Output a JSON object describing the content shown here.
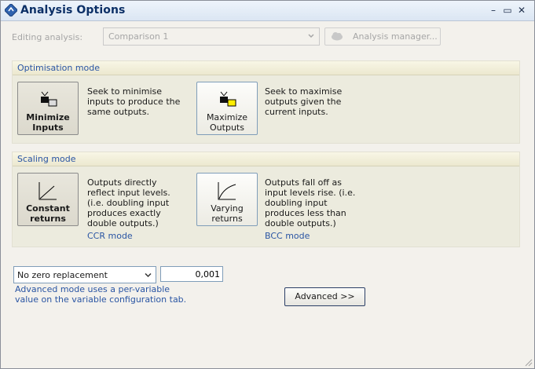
{
  "window": {
    "title": "Analysis Options",
    "icon": "app-logo-icon"
  },
  "controls": {
    "minimize": "–",
    "maximize": "▭",
    "close": "✕"
  },
  "toolbar": {
    "editing_label": "Editing analysis:",
    "analysis_value": "Comparison 1",
    "manager_label": "Analysis manager..."
  },
  "optimisation": {
    "header": "Optimisation mode",
    "minimize_label_1": "Minimize",
    "minimize_label_2": "Inputs",
    "minimize_desc": "Seek to minimise inputs to produce the same outputs.",
    "maximize_label_1": "Maximize",
    "maximize_label_2": "Outputs",
    "maximize_desc": "Seek to maximise outputs given the current inputs."
  },
  "scaling": {
    "header": "Scaling mode",
    "constant_label_1": "Constant",
    "constant_label_2": "returns",
    "constant_desc": "Outputs directly reflect input levels. (i.e. doubling input produces exactly double outputs.)",
    "constant_link": "CCR mode",
    "varying_label_1": "Varying",
    "varying_label_2": "returns",
    "varying_desc": "Outputs fall off as input levels rise. (i.e. doubling input produces less than double outputs.)",
    "varying_link": "BCC mode"
  },
  "zero": {
    "selected": "No zero replacement",
    "value": "0,001",
    "note": "Advanced mode uses a per-variable value on the variable configuration tab."
  },
  "advanced_label": "Advanced >>"
}
